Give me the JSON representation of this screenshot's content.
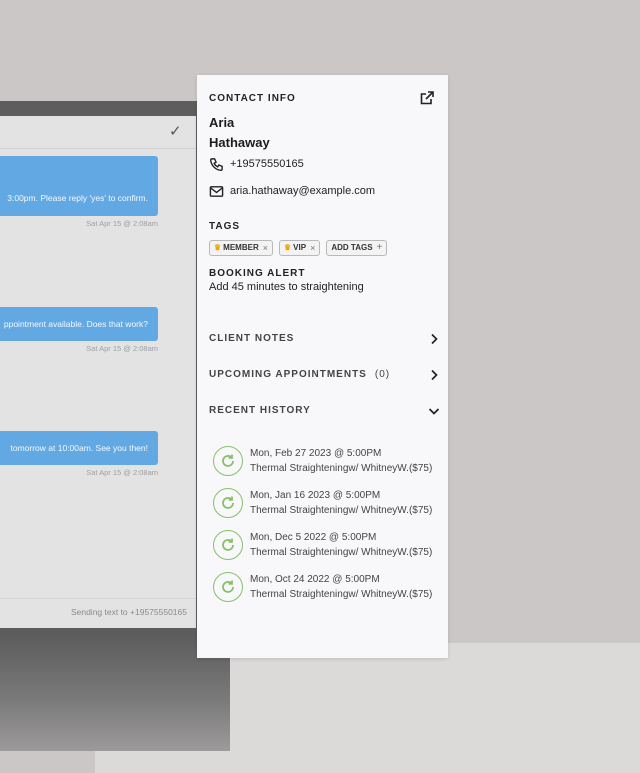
{
  "chat": {
    "messages": [
      {
        "text": "3:00pm. Please reply 'yes' to confirm.",
        "time": "Sat Apr 15 @ 2:08am"
      },
      {
        "text": "ppointment available. Does that work?",
        "time": "Sat Apr 15 @ 2:08am"
      },
      {
        "text": "tomorrow at 10:00am. See you then!",
        "time": "Sat Apr 15 @ 2:08am"
      }
    ],
    "sending_text": "Sending text to +19575550165"
  },
  "contact": {
    "section_title": "CONTACT INFO",
    "first_name": "Aria",
    "last_name": "Hathaway",
    "phone": "+19575550165",
    "email": "aria.hathaway@example.com"
  },
  "tags": {
    "title": "TAGS",
    "items": [
      {
        "label": "MEMBER"
      },
      {
        "label": "VIP"
      }
    ],
    "add_label": "ADD TAGS"
  },
  "booking_alert": {
    "title": "BOOKING ALERT",
    "text": "Add 45 minutes to straightening"
  },
  "sections": {
    "client_notes": "CLIENT NOTES",
    "upcoming_appointments": "UPCOMING APPOINTMENTS",
    "upcoming_count": "(0)",
    "recent_history": "RECENT HISTORY"
  },
  "history": [
    {
      "date": "Mon, Feb 27 2023 @ 5:00PM",
      "service": "Thermal Straighteningw/ WhitneyW.($75)"
    },
    {
      "date": "Mon, Jan 16 2023 @ 5:00PM",
      "service": "Thermal Straighteningw/ WhitneyW.($75)"
    },
    {
      "date": "Mon, Dec 5 2022 @ 5:00PM",
      "service": "Thermal Straighteningw/ WhitneyW.($75)"
    },
    {
      "date": "Mon, Oct 24 2022 @ 5:00PM",
      "service": "Thermal Straighteningw/ WhitneyW.($75)"
    }
  ],
  "icons": {
    "external": "external-link-icon",
    "phone": "phone-icon",
    "email": "envelope-icon",
    "chevron_right": "chevron-right-icon",
    "chevron_down": "chevron-down-icon",
    "history": "refresh-icon",
    "crown": "crown-icon"
  },
  "colors": {
    "bubble": "#62a9e3",
    "history_ring": "#87c06a",
    "crown": "#f0a500"
  }
}
